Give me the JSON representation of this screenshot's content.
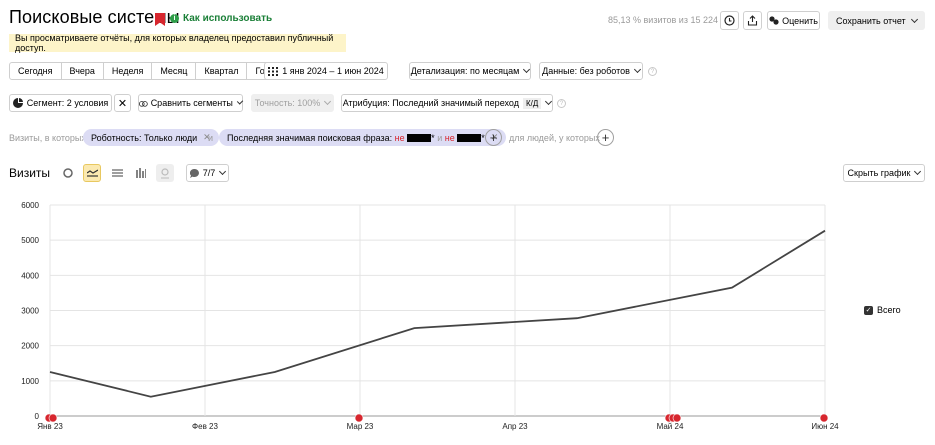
{
  "header": {
    "title": "Поисковые системы",
    "how_to": "Как использовать",
    "visits_share": "85,13 % визитов из 15 224",
    "rate_label": "Оценить",
    "save_report": "Сохранить отчет"
  },
  "notice": "Вы просматриваете отчёты, для которых владелец предоставил публичный доступ.",
  "periods": [
    "Сегодня",
    "Вчера",
    "Неделя",
    "Месяц",
    "Квартал",
    "Год"
  ],
  "date_range": "1 янв 2024 – 1 июн 2024",
  "detail": "Детализация: по месяцам",
  "data_filter": "Данные: без роботов",
  "segment": "Сегмент: 2 условия",
  "compare": "Сравнить сегменты",
  "accuracy": "Точность: 100%",
  "attribution": "Атрибуция: Последний значимый переход",
  "attribution_badge": "К/Д",
  "filters": {
    "visits_prefix": "Визиты, в которых",
    "chip1": "Роботность: Только люди",
    "and": "и",
    "chip2_label": "Последняя значимая поисковая фраза:",
    "chip2_neg1": "не",
    "chip2_or": "и",
    "chip2_neg2": "не",
    "people_prefix": "для людей, у которых"
  },
  "visits_section": {
    "title": "Визиты",
    "counter": "7/7",
    "hide_chart": "Скрыть график"
  },
  "legend": {
    "total": "Всего"
  },
  "chart_data": {
    "type": "line",
    "title": "",
    "xlabel": "",
    "ylabel": "",
    "x": [
      "Янв 23",
      "Фев 23",
      "Мар 23",
      "Апр 23",
      "Май 24",
      "Июн 24"
    ],
    "ylim": [
      0,
      6000
    ],
    "y_ticks": [
      "0",
      "1000",
      "2000",
      "3000",
      "4000",
      "5000",
      "6000"
    ],
    "grid": true,
    "legend_position": "right",
    "series": [
      {
        "name": "Всего",
        "color": "#444444",
        "points": [
          {
            "t": 0,
            "y": 1250
          },
          {
            "t": 0.65,
            "y": 550
          },
          {
            "t": 1.45,
            "y": 1250
          },
          {
            "t": 2.35,
            "y": 2500
          },
          {
            "t": 3.4,
            "y": 2780
          },
          {
            "t": 4.4,
            "y": 3650
          },
          {
            "t": 5,
            "y": 5270
          }
        ]
      }
    ],
    "annotations": [
      {
        "t": 0,
        "count": 2
      },
      {
        "t": 2,
        "count": 1
      },
      {
        "t": 4,
        "count": 3
      },
      {
        "t": 5,
        "count": 1
      }
    ]
  }
}
